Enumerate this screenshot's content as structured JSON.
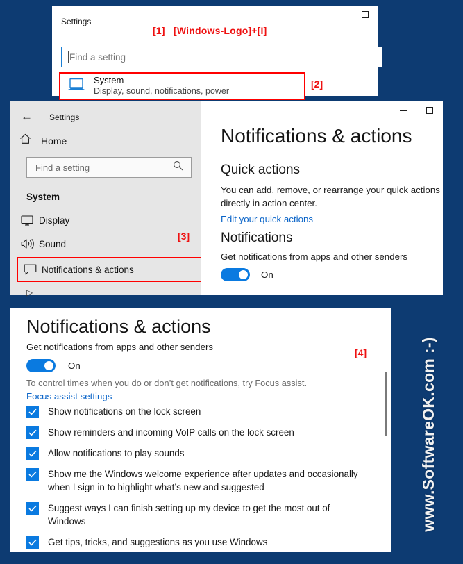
{
  "background_color": "#0d3b72",
  "accent_color": "#0a7ae0",
  "link_color": "#0a64c8",
  "marker_color": "#ee1111",
  "highlight_box_color": "#ff0000",
  "watermark": "www.SoftwareOK.com  :-)",
  "panel1": {
    "title": "Settings",
    "step_marker": "[1]",
    "step_hint": "[Windows-Logo]+[I]",
    "search_placeholder": "Find a setting",
    "system_title": "System",
    "system_subtitle": "Display, sound, notifications, power",
    "system_icon": "laptop-icon",
    "step2_marker": "[2]",
    "minimize_label": "Minimize",
    "maximize_label": "Maximize"
  },
  "panel2": {
    "back_icon": "back-arrow-icon",
    "title": "Settings",
    "home_icon": "home-icon",
    "home_label": "Home",
    "search_placeholder": "Find a setting",
    "search_icon": "search-icon",
    "section_header": "System",
    "nav_items": [
      {
        "label": "Display",
        "icon": "monitor-icon"
      },
      {
        "label": "Sound",
        "icon": "speaker-icon"
      },
      {
        "label": "Notifications & actions",
        "icon": "notification-icon"
      }
    ],
    "step3_marker": "[3]",
    "page_title": "Notifications & actions",
    "quick_actions_heading": "Quick actions",
    "quick_actions_desc": "You can add, remove, or rearrange your quick actions directly in action center.",
    "quick_actions_link": "Edit your quick actions",
    "notifications_heading": "Notifications",
    "notifications_desc": "Get notifications from apps and other senders",
    "toggle_state": "On"
  },
  "panel3": {
    "page_title": "Notifications & actions",
    "subtitle": "Get notifications from apps and other senders",
    "toggle_state": "On",
    "focus_note": "To control times when you do or don’t get notifications, try Focus assist.",
    "focus_link": "Focus assist settings",
    "step4_marker": "[4]",
    "checkboxes": [
      {
        "label": "Show notifications on the lock screen",
        "checked": true
      },
      {
        "label": "Show reminders and incoming VoIP calls on the lock screen",
        "checked": true
      },
      {
        "label": "Allow notifications to play sounds",
        "checked": true
      },
      {
        "label": "Show me the Windows welcome experience after updates and occasionally when I sign in to highlight what’s new and suggested",
        "checked": true
      },
      {
        "label": "Suggest ways I can finish setting up my device to get the most out of Windows",
        "checked": true
      },
      {
        "label": "Get tips, tricks, and suggestions as you use Windows",
        "checked": true
      }
    ]
  }
}
